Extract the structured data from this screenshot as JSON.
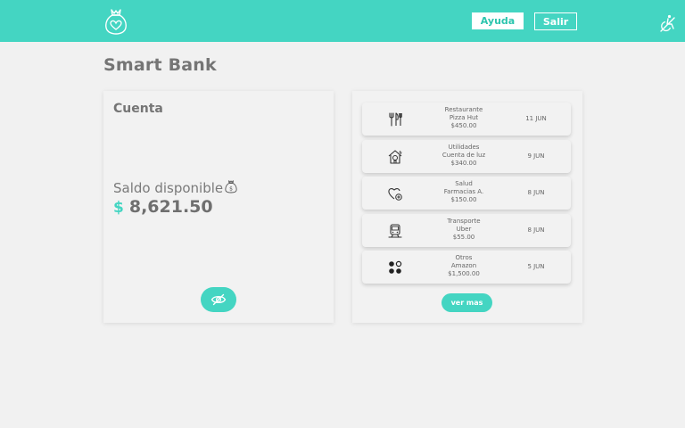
{
  "header": {
    "logo_icon": "money-bag-heart-icon",
    "help_label": "Ayuda",
    "exit_label": "Salir",
    "accessibility_icon": "wheelchair-icon",
    "bar_color": "#44d5c2"
  },
  "page": {
    "title": "Smart Bank"
  },
  "account": {
    "title": "Cuenta",
    "balance_label": "Saldo disponible",
    "balance_icon": "money-bag-icon",
    "currency_symbol": "$",
    "balance_amount": "8,621.50",
    "toggle_icon": "eye-slash-icon"
  },
  "transactions": {
    "items": [
      {
        "icon": "restaurant-icon",
        "category": "Restaurante",
        "merchant": "Pizza Hut",
        "amount": "$450.00",
        "date": "11 JUN"
      },
      {
        "icon": "utility-house-icon",
        "category": "Utilidades",
        "merchant": "Cuenta de luz",
        "amount": "$340.00",
        "date": "9 JUN"
      },
      {
        "icon": "health-heart-icon",
        "category": "Salud",
        "merchant": "Farmacias A.",
        "amount": "$150.00",
        "date": "8 JUN"
      },
      {
        "icon": "train-icon",
        "category": "Transporte",
        "merchant": "Uber",
        "amount": "$55.00",
        "date": "8 JUN"
      },
      {
        "icon": "other-dots-icon",
        "category": "Otros",
        "merchant": "Amazon",
        "amount": "$1,500.00",
        "date": "5 JUN"
      }
    ],
    "more_label": "ver mas"
  }
}
